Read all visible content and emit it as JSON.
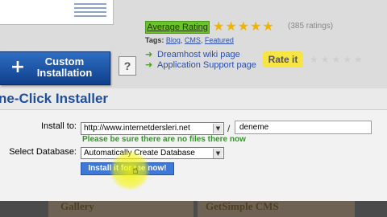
{
  "header": {
    "custom_install_label": "Custom Installation",
    "help_label": "?",
    "rating_badge": "Average Rating",
    "stars": "★★★★★",
    "ratings_count": "(385 ratings)",
    "tags_label": "Tags:",
    "tags": [
      "Blog",
      "CMS",
      "Featured"
    ],
    "links": [
      "Dreamhost wiki page",
      "Application Support page"
    ],
    "rate_it": "Rate it",
    "faded_stars": "★★★★★"
  },
  "installer": {
    "title": "ne-Click Installer",
    "install_to_label": "Install to:",
    "url_value": "http://www.internetdersleri.net",
    "slash": "/",
    "directory_value": "deneme",
    "warning": "Please be sure there are no files there now",
    "select_db_label": "Select Database:",
    "db_value": "Automatically Create Database",
    "install_button": "Install it for me now!"
  },
  "bottom": {
    "gallery": "Gallery",
    "getsimple": "GetSimple CMS"
  },
  "colors": {
    "link_blue": "#2b4fa8",
    "heading_blue": "#1f4f9a",
    "warning_green": "#2f9a23",
    "rate_yellow": "#f7e544",
    "star_gold": "#f0b400"
  }
}
